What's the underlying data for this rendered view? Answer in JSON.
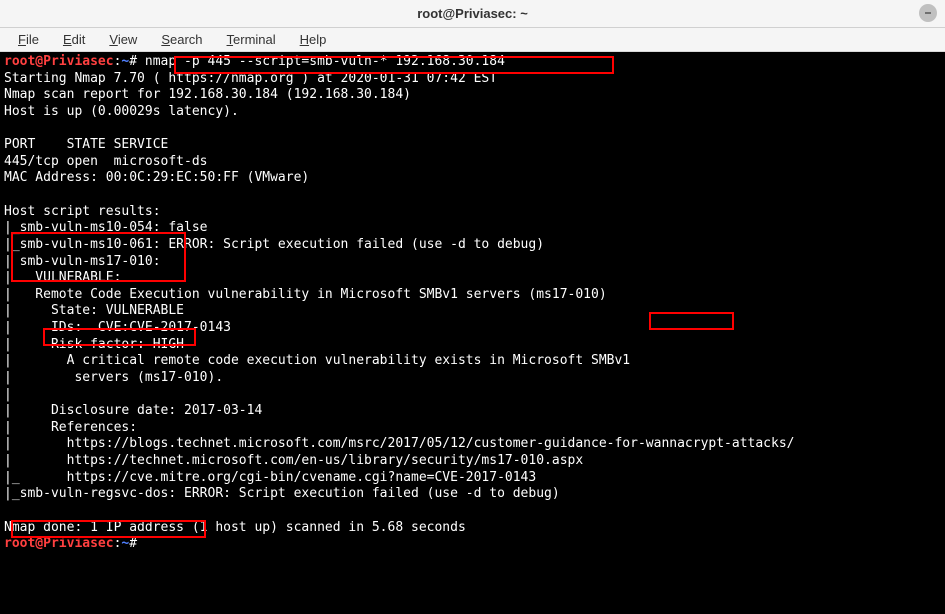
{
  "window": {
    "title": "root@Priviasec: ~"
  },
  "menu": {
    "file": "File",
    "edit": "Edit",
    "view": "View",
    "search": "Search",
    "terminal": "Terminal",
    "help": "Help"
  },
  "prompt": {
    "user_host": "root@Priviasec",
    "path": "~",
    "sep1": ":",
    "hash": "#"
  },
  "term": {
    "cmd": "nmap -p 445 --script=smb-vuln-* 192.168.30.184",
    "l1": "Starting Nmap 7.70 ( https://nmap.org ) at 2020-01-31 07:42 EST",
    "l2": "Nmap scan report for 192.168.30.184 (192.168.30.184)",
    "l3": "Host is up (0.00029s latency).",
    "l4": "",
    "l5": "PORT    STATE SERVICE",
    "l6": "445/tcp open  microsoft-ds",
    "l7": "MAC Address: 00:0C:29:EC:50:FF (VMware)",
    "l8": "",
    "l9": "Host script results:",
    "l10": "|_smb-vuln-ms10-054: false",
    "l11": "|_smb-vuln-ms10-061: ERROR: Script execution failed (use -d to debug)",
    "l12": "| smb-vuln-ms17-010: ",
    "l13": "|   VULNERABLE:",
    "l14": "|   Remote Code Execution vulnerability in Microsoft SMBv1 servers (ms17-010)",
    "l15": "|     State: VULNERABLE",
    "l16": "|     IDs:  CVE:CVE-2017-0143",
    "l17": "|     Risk factor: HIGH",
    "l18": "|       A critical remote code execution vulnerability exists in Microsoft SMBv1",
    "l19": "|        servers (ms17-010).",
    "l20": "|           ",
    "l21": "|     Disclosure date: 2017-03-14",
    "l22": "|     References:",
    "l23": "|       https://blogs.technet.microsoft.com/msrc/2017/05/12/customer-guidance-for-wannacrypt-attacks/",
    "l24": "|       https://technet.microsoft.com/en-us/library/security/ms17-010.aspx",
    "l25": "|_      https://cve.mitre.org/cgi-bin/cvename.cgi?name=CVE-2017-0143",
    "l26": "|_smb-vuln-regsvc-dos: ERROR: Script execution failed (use -d to debug)",
    "l27": "",
    "l28": "Nmap done: 1 IP address (1 host up) scanned in 5.68 seconds"
  }
}
